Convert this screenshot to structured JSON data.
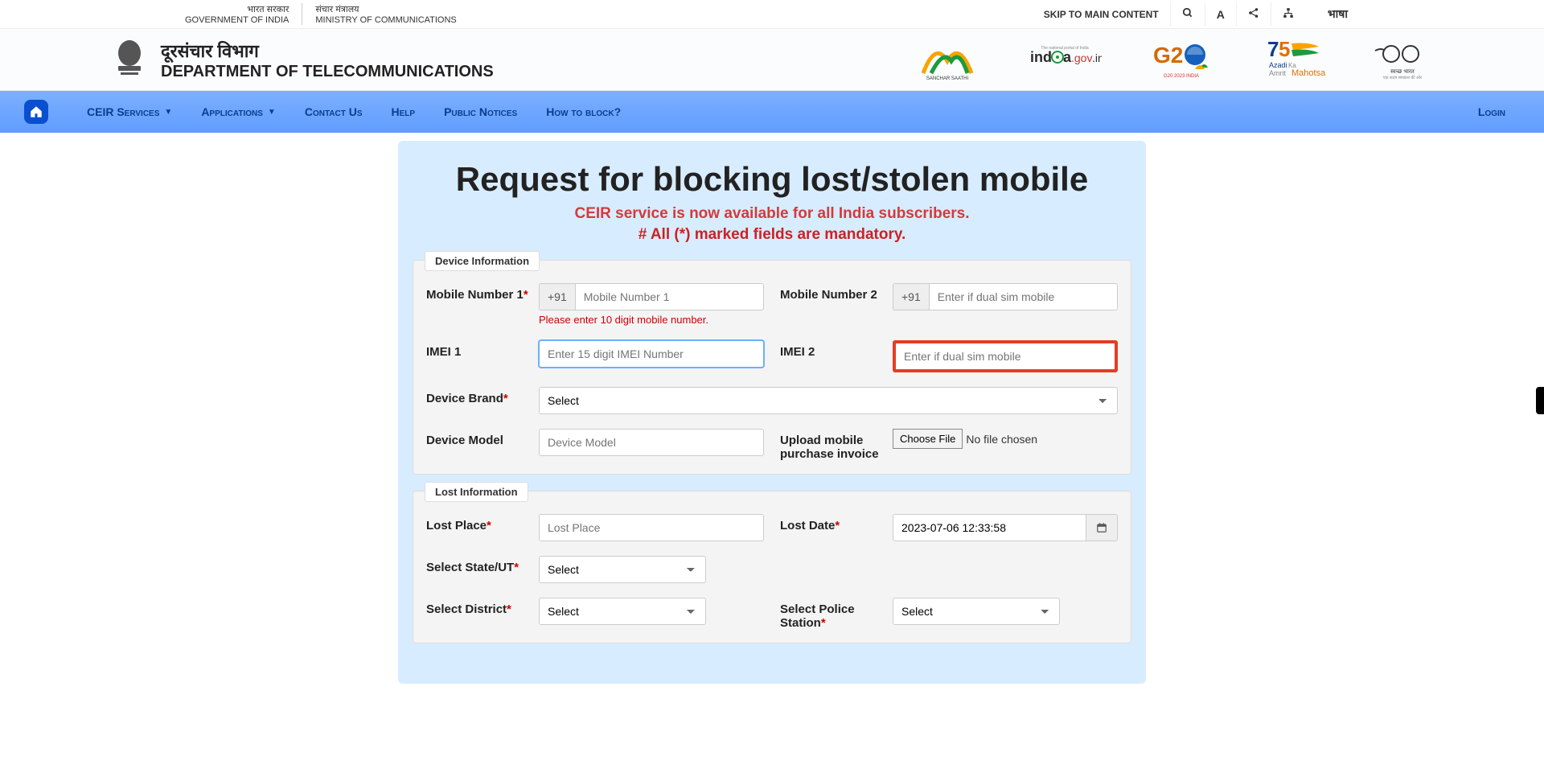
{
  "top": {
    "gov_hi": "भारत सरकार",
    "gov_en": "GOVERNMENT OF INDIA",
    "min_hi": "संचार मंत्रालय",
    "min_en": "MINISTRY OF COMMUNICATIONS",
    "skip": "SKIP TO MAIN CONTENT",
    "lang": "भाषा"
  },
  "header": {
    "dept_hi": "दूरसंचार विभाग",
    "dept_en": "DEPARTMENT OF TELECOMMUNICATIONS"
  },
  "partners": {
    "p1": "SANCHAR SAATHI",
    "p2": "india.gov.in",
    "p3": "G20 2023 INDIA",
    "p4": "Azadi Ka Amrit Mahotsav",
    "p5": "स्वच्छ भारत"
  },
  "nav": {
    "ceir": "CEIR Services",
    "apps": "Applications",
    "contact": "Contact Us",
    "help": "Help",
    "notices": "Public Notices",
    "howto": "How to block?",
    "login": "Login"
  },
  "form": {
    "title": "Request for blocking lost/stolen mobile",
    "sub1": "CEIR service is now available for all India subscribers.",
    "sub2": "# All (*) marked fields are mandatory."
  },
  "device": {
    "legend": "Device Information",
    "mob1_lbl": "Mobile Number 1",
    "mob2_lbl": "Mobile Number 2",
    "prefix": "+91",
    "mob1_ph": "Mobile Number 1",
    "mob2_ph": "Enter if dual sim mobile",
    "mob1_err": "Please enter 10 digit mobile number.",
    "imei1_lbl": "IMEI 1",
    "imei2_lbl": "IMEI 2",
    "imei1_ph": "Enter 15 digit IMEI Number",
    "imei2_ph": "Enter if dual sim mobile",
    "brand_lbl": "Device Brand",
    "brand_opt": "Select",
    "model_lbl": "Device Model",
    "model_ph": "Device Model",
    "upload_lbl": "Upload mobile purchase invoice",
    "choose": "Choose File",
    "nofile": "No file chosen"
  },
  "lost": {
    "legend": "Lost Information",
    "place_lbl": "Lost Place",
    "place_ph": "Lost Place",
    "date_lbl": "Lost Date",
    "date_val": "2023-07-06 12:33:58",
    "state_lbl": "Select State/UT",
    "district_lbl": "Select District",
    "police_lbl": "Select Police Station",
    "select": "Select"
  }
}
